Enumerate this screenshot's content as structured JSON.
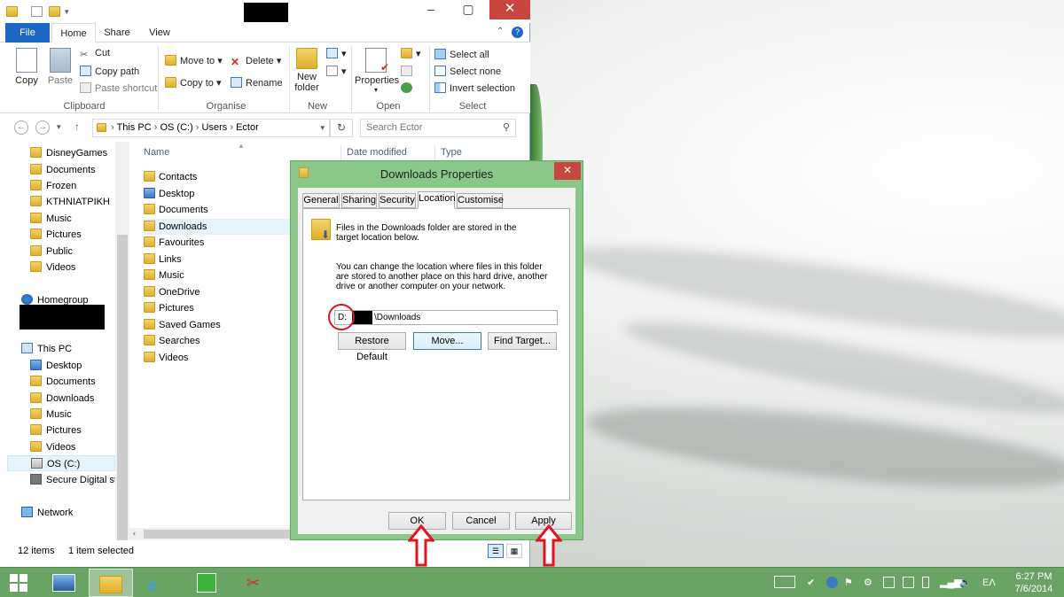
{
  "explorer": {
    "tabs": {
      "file": "File",
      "home": "Home",
      "share": "Share",
      "view": "View"
    },
    "ribbon": {
      "clipboard": {
        "copy": "Copy",
        "paste": "Paste",
        "cut": "Cut",
        "copy_path": "Copy path",
        "paste_shortcut": "Paste shortcut",
        "label": "Clipboard"
      },
      "organise": {
        "move_to": "Move to",
        "copy_to": "Copy to",
        "delete": "Delete",
        "rename": "Rename",
        "label": "Organise"
      },
      "new": {
        "new_folder_line1": "New",
        "new_folder_line2": "folder",
        "label": "New"
      },
      "open": {
        "properties": "Properties",
        "label": "Open"
      },
      "select": {
        "select_all": "Select all",
        "select_none": "Select none",
        "invert": "Invert selection",
        "label": "Select"
      }
    },
    "address": {
      "path": [
        "This PC",
        "OS (C:)",
        "Users",
        "Ector"
      ],
      "search_placeholder": "Search Ector"
    },
    "nav": {
      "user_folders": [
        "DisneyGames",
        "Documents",
        "Frozen",
        "KTHNIATPIKH",
        "Music",
        "Pictures",
        "Public",
        "Videos"
      ],
      "homegroup": "Homegroup",
      "this_pc": "This PC",
      "pc_items": [
        "Desktop",
        "Documents",
        "Downloads",
        "Music",
        "Pictures",
        "Videos",
        "OS (C:)",
        "Secure Digital sto"
      ],
      "network": "Network"
    },
    "columns": {
      "name": "Name",
      "date": "Date modified",
      "type": "Type"
    },
    "files": [
      "Contacts",
      "Desktop",
      "Documents",
      "Downloads",
      "Favourites",
      "Links",
      "Music",
      "OneDrive",
      "Pictures",
      "Saved Games",
      "Searches",
      "Videos"
    ],
    "status": {
      "count": "12 items",
      "selected": "1 item selected"
    }
  },
  "dialog": {
    "title": "Downloads Properties",
    "tabs": [
      "General",
      "Sharing",
      "Security",
      "Location",
      "Customise"
    ],
    "info": "Files in the Downloads folder are stored in the target location below.",
    "desc": "You can change the location where files in this folder are stored to another place on this hard drive, another drive or another computer on your network.",
    "path_prefix": "D:",
    "path_suffix": "\\Downloads",
    "buttons": {
      "restore": "Restore Default",
      "move": "Move...",
      "find": "Find Target...",
      "ok": "OK",
      "cancel": "Cancel",
      "apply": "Apply"
    }
  },
  "taskbar": {
    "time": "6:27 PM",
    "date": "7/6/2014",
    "lang": "EΛ"
  },
  "colors": {
    "accent_green": "#6aa464",
    "file_tab_blue": "#1a67c4",
    "close_red": "#c7463d",
    "annotation_red": "#e0141e"
  }
}
